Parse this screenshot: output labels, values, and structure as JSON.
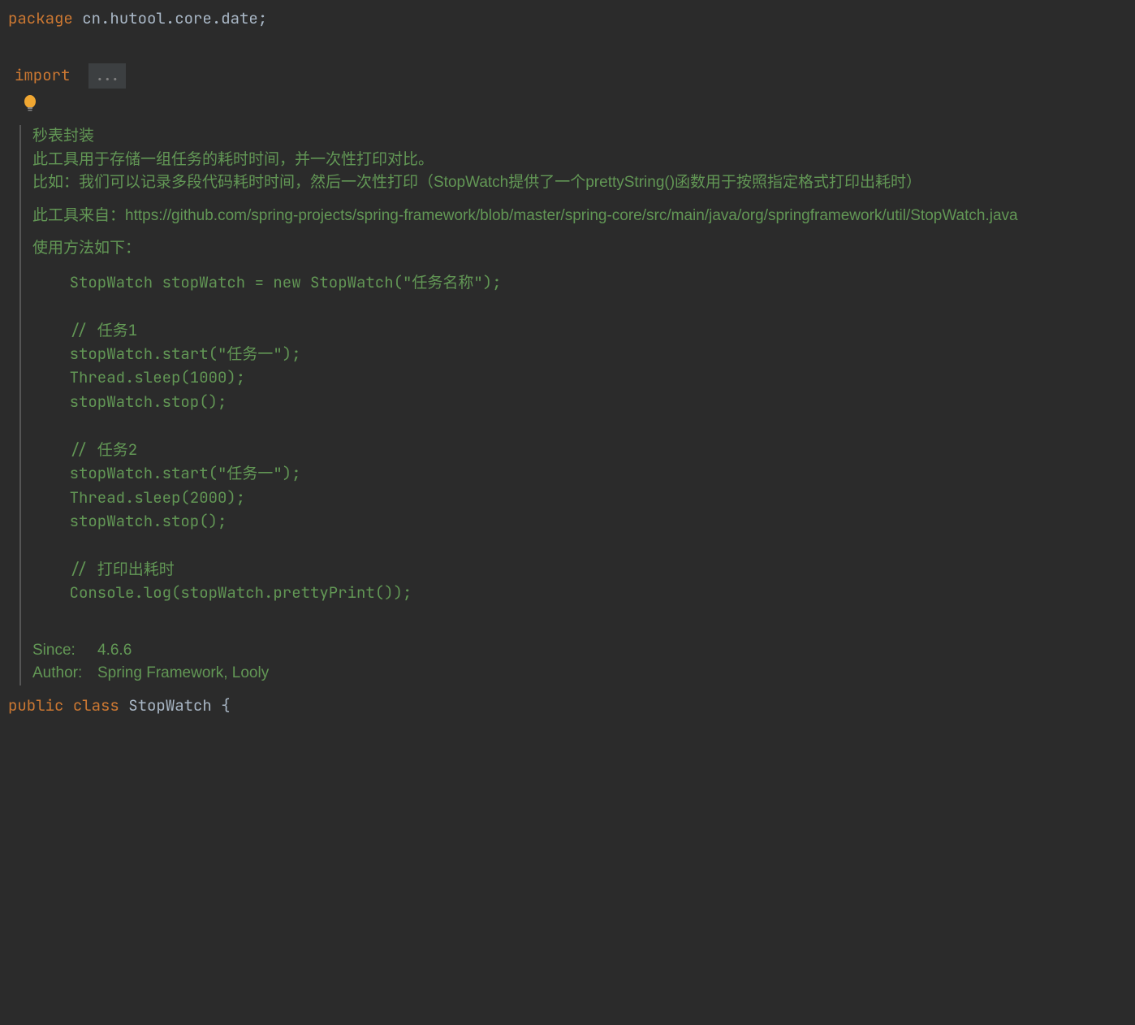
{
  "code": {
    "package_keyword": "package",
    "package_name": " cn.hutool.core.date",
    "semicolon": ";",
    "import_keyword": "import",
    "import_fold": "...",
    "public_keyword": "public ",
    "class_keyword": "class ",
    "class_name": "StopWatch ",
    "open_brace": "{"
  },
  "javadoc": {
    "title": "秒表封装",
    "desc1": "此工具用于存储一组任务的耗时时间，并一次性打印对比。",
    "desc2": "比如：我们可以记录多段代码耗时时间，然后一次性打印（StopWatch提供了一个prettyString()函数用于按照指定格式打印出耗时）",
    "source": "此工具来自：https://github.com/spring-projects/spring-framework/blob/master/spring-core/src/main/java/org/springframework/util/StopWatch.java",
    "usage_label": "使用方法如下：",
    "code_example": "    StopWatch stopWatch = new StopWatch(\"任务名称\");\n\n    // 任务1\n    stopWatch.start(\"任务一\");\n    Thread.sleep(1000);\n    stopWatch.stop();\n\n    // 任务2\n    stopWatch.start(\"任务一\");\n    Thread.sleep(2000);\n    stopWatch.stop();\n\n    // 打印出耗时\n    Console.log(stopWatch.prettyPrint());\n",
    "since_label": "Since:",
    "since_value": "4.6.6",
    "author_label": "Author:",
    "author_value": "Spring Framework, Looly"
  },
  "icons": {
    "bulb": "bulb"
  }
}
